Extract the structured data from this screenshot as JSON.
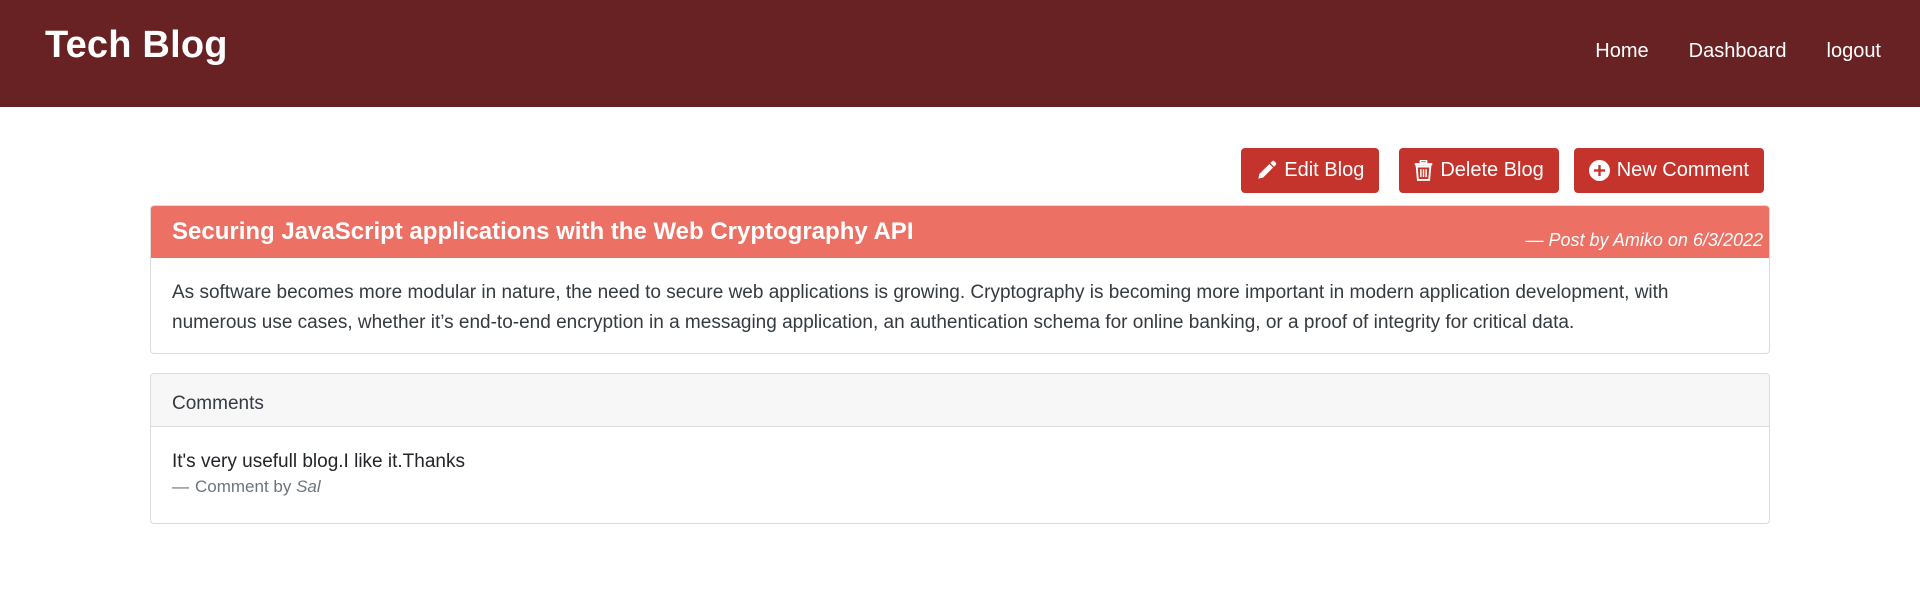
{
  "navbar": {
    "brand": "Tech Blog",
    "links": [
      "Home",
      "Dashboard",
      "logout"
    ]
  },
  "toolbar": {
    "edit_label": "Edit Blog",
    "delete_label": "Delete Blog",
    "new_comment_label": "New Comment"
  },
  "post": {
    "title": "Securing JavaScript applications with the Web Cryptography API",
    "meta_prefix": "— Post by ",
    "author": "Amiko",
    "meta_on": " on ",
    "date": "6/3/2022",
    "body": "As software becomes more modular in nature, the need to secure web applications is growing. Cryptography is becoming more important in modern application development, with numerous use cases, whether it’s end-to-end encryption in a messaging application, an authentication schema for online banking, or a proof of integrity for critical data."
  },
  "comments": {
    "header": "Comments",
    "items": [
      {
        "text": "It's very usefull blog.I like it.Thanks",
        "dash": "—",
        "by_label": "Comment by ",
        "author": "Sal"
      }
    ]
  },
  "colors": {
    "navbar_bg": "#692223",
    "button_bg": "#c4342c",
    "post_header_bg": "#ec7063"
  },
  "icons": {
    "edit": "pencil-icon",
    "delete": "trash-icon",
    "new_comment": "plus-circle-icon"
  }
}
